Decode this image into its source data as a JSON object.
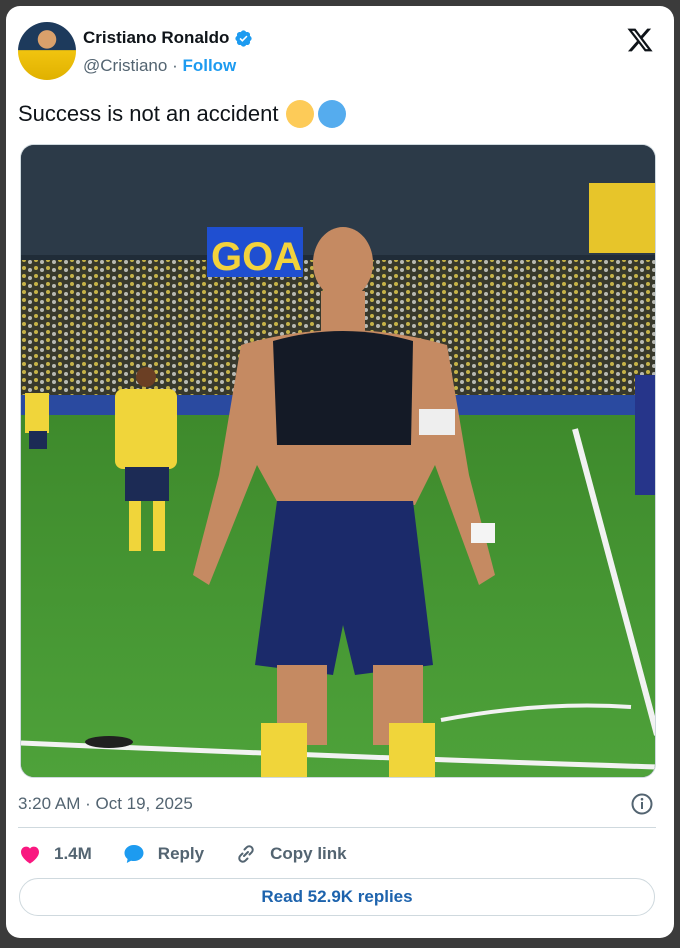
{
  "author": {
    "name": "Cristiano Ronaldo",
    "handle": "@Cristiano",
    "separator": " · ",
    "follow_label": "Follow"
  },
  "tweet": {
    "text": "Success is not an accident",
    "emojis": [
      "yellow-circle",
      "blue-circle"
    ],
    "timestamp": "3:20 AM · Oct 19, 2025"
  },
  "media": {
    "scoreboard_text": "GOA"
  },
  "actions": {
    "likes": "1.4M",
    "reply_label": "Reply",
    "copy_label": "Copy link"
  },
  "replies_button": "Read 52.9K replies",
  "colors": {
    "accent": "#1d9bf0",
    "heart": "#f91880",
    "emoji_yellow": "#fdcb58",
    "emoji_blue": "#55acee"
  }
}
